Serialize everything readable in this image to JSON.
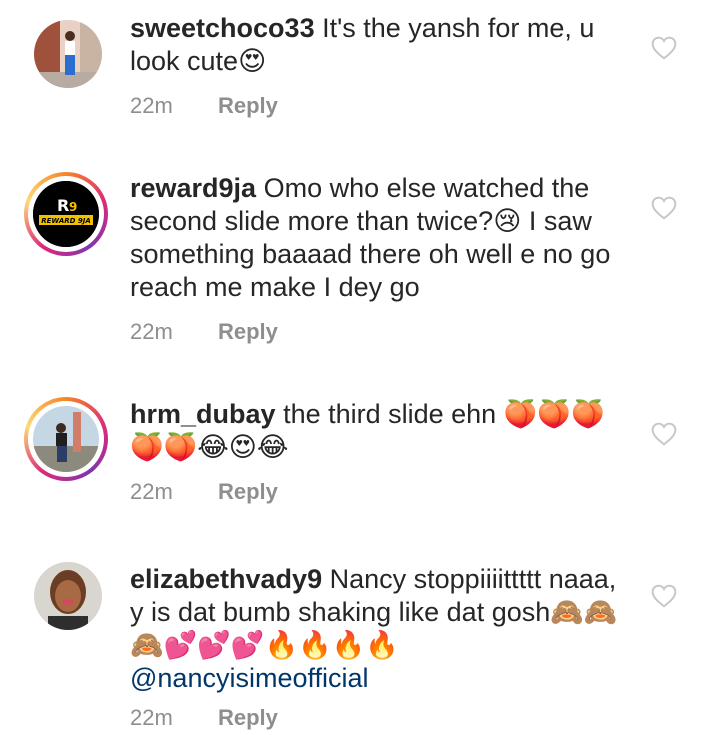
{
  "comments": [
    {
      "username": "sweetchoco33",
      "text": "It's the yansh for me, u look cute😍",
      "time": "22m",
      "reply": "Reply"
    },
    {
      "username": "reward9ja",
      "text": "Omo who else watched the second slide more than twice?😢 I saw something baaaad there oh well e no go reach me make I dey go",
      "time": "22m",
      "reply": "Reply",
      "avatar_logo": "REWARD 9JA"
    },
    {
      "username": "hrm_dubay",
      "text": "the third slide ehn 🍑🍑🍑🍑🍑😂😍😂",
      "time": "22m",
      "reply": "Reply"
    },
    {
      "username": "elizabethvady9",
      "text": "Nancy stoppiiiittttt naaa, y is dat bumb shaking like dat gosh🙈🙈🙈💕💕💕🔥🔥🔥🔥",
      "mention": "@nancyisimeofficial",
      "time": "22m",
      "reply": "Reply"
    }
  ],
  "icons": {
    "like": "heart-outline-icon"
  },
  "colors": {
    "text": "#262626",
    "meta": "#8e8e8e",
    "mention": "#00376b",
    "heart": "#c7c7c7"
  }
}
